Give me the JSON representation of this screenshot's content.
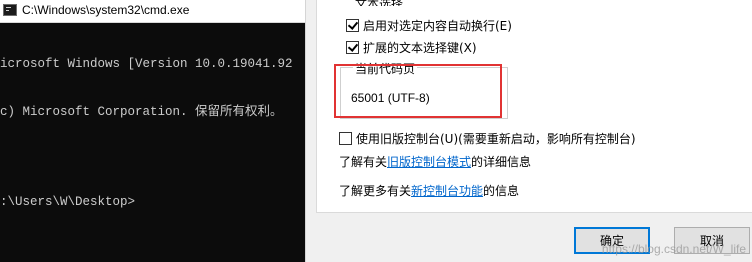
{
  "console": {
    "title": "C:\\Windows\\system32\\cmd.exe",
    "lines": [
      "icrosoft Windows [Version 10.0.19041.92",
      "c) Microsoft Corporation. 保留所有权利。",
      ":\\Users\\W\\Desktop>"
    ]
  },
  "dialog": {
    "group_caption": "文本选择",
    "options": [
      {
        "label": "启用对选定内容自动换行(E)",
        "checked": true
      },
      {
        "label": "扩展的文本选择键(X)",
        "checked": true
      }
    ],
    "codepage": {
      "caption": "当前代码页",
      "value": "65001 (UTF-8)"
    },
    "legacy": {
      "label": "使用旧版控制台(U)(需要重新启动，影响所有控制台)",
      "checked": false
    },
    "info1": {
      "prefix": "了解有关",
      "link": "旧版控制台模式",
      "suffix": "的详细信息"
    },
    "info2": {
      "prefix": "了解更多有关",
      "link": "新控制台功能",
      "suffix": "的信息"
    },
    "buttons": {
      "ok": "确定",
      "cancel": "取消"
    }
  },
  "watermark": "https://blog.csdn.net/W_life",
  "colors": {
    "highlight": "#e13333",
    "link": "#0066cc",
    "console_bg": "#0c0c0c"
  }
}
